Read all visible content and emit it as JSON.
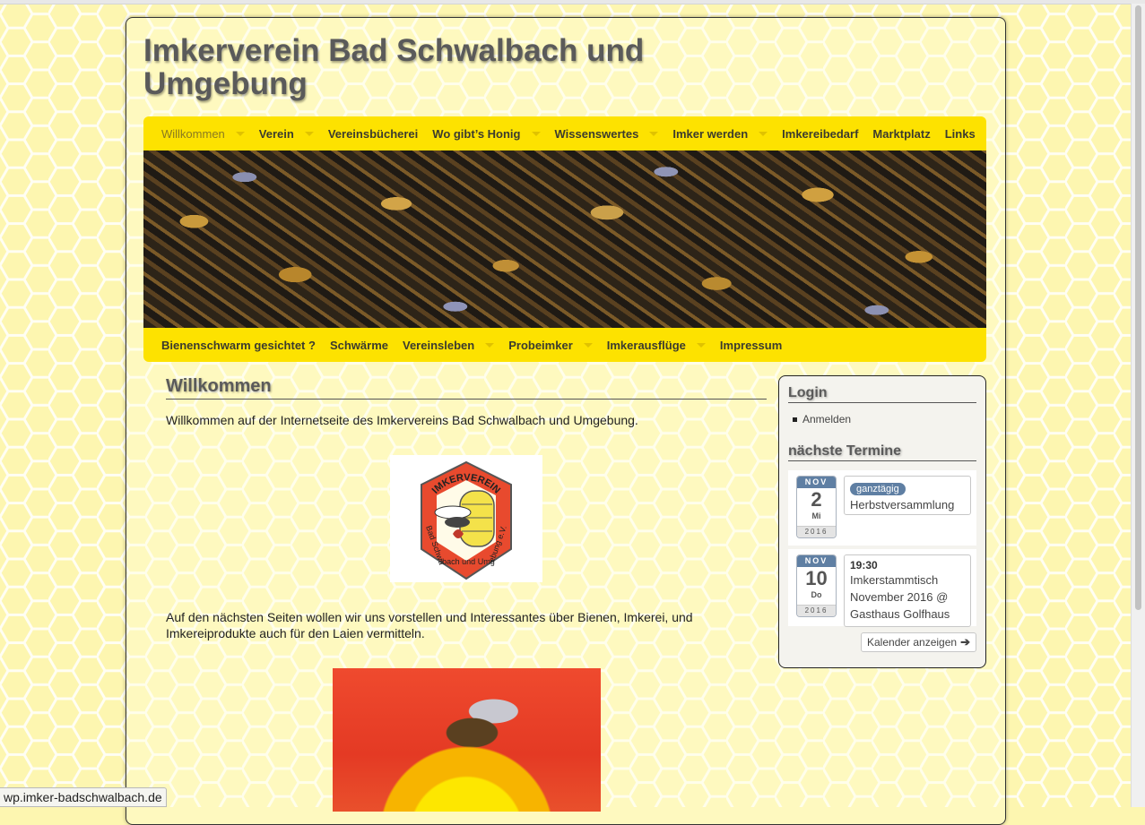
{
  "site": {
    "title": "Imkerverein Bad Schwalbach und Umgebung"
  },
  "nav_top": [
    {
      "label": "Willkommen",
      "active": true,
      "has_submenu": true
    },
    {
      "label": "Verein",
      "has_submenu": true
    },
    {
      "label": "Vereinsbücherei",
      "has_submenu": false
    },
    {
      "label": "Wo gibt’s Honig",
      "has_submenu": true
    },
    {
      "label": "Wissenswertes",
      "has_submenu": true
    },
    {
      "label": "Imker werden",
      "has_submenu": true
    },
    {
      "label": "Imkereibedarf",
      "has_submenu": false
    },
    {
      "label": "Marktplatz",
      "has_submenu": false
    },
    {
      "label": "Links",
      "has_submenu": false
    }
  ],
  "nav_bottom": [
    {
      "label": "Bienenschwarm gesichtet ?",
      "has_submenu": false
    },
    {
      "label": "Schwärme",
      "has_submenu": false
    },
    {
      "label": "Vereinsleben",
      "has_submenu": true
    },
    {
      "label": "Probeimker",
      "has_submenu": true
    },
    {
      "label": "Imkerausflüge",
      "has_submenu": true
    },
    {
      "label": "Impressum",
      "has_submenu": false
    }
  ],
  "main": {
    "title": "Willkommen",
    "intro": "Willkommen auf der Internetseite des Imkervereins Bad Schwalbach und Umgebung.",
    "paragraph2": "Auf den nächsten Seiten wollen wir uns vorstellen und Interessantes über Bienen, Imkerei, und Imkereiprodukte auch für den Laien vermitteln.",
    "logo": {
      "top_text": "IMKERVEREIN",
      "side_text": "Bad Schwalbach und Umgebung e.V."
    }
  },
  "sidebar": {
    "login_title": "Login",
    "login_link": "Anmelden",
    "events_title": "nächste Termine",
    "events": [
      {
        "month": "NOV",
        "day": "2",
        "weekday": "Mi",
        "year": "2016",
        "badge": "ganztägig",
        "time": "",
        "title": "Herbstversammlung"
      },
      {
        "month": "NOV",
        "day": "10",
        "weekday": "Do",
        "year": "2016",
        "badge": "",
        "time": "19:30",
        "title": "Imkerstammtisch November 2016 @ Gasthaus Golfhaus"
      }
    ],
    "calendar_button": "Kalender anzeigen"
  },
  "status_url": "wp.imker-badschwalbach.de",
  "colors": {
    "nav_yellow": "#fde200",
    "background": "#fdf6b0",
    "badge_blue": "#5f7fa3"
  }
}
